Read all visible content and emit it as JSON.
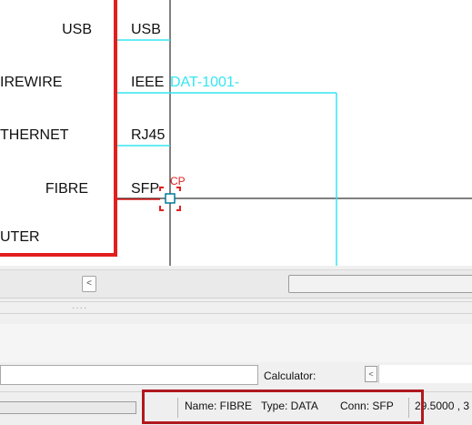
{
  "diagram": {
    "device_labels": [
      "USB",
      "IREWIRE",
      "THERNET",
      "FIBRE",
      "UTER"
    ],
    "connectors": [
      "USB",
      "IEEE",
      "RJ45",
      "SFP"
    ],
    "wire_label": "DAT-1001-",
    "cp_marker": "CP",
    "colors": {
      "device_border": "#e31e1e",
      "wire": "#33e6f0",
      "selection": "#e31e1e",
      "crosshair": "#000000"
    }
  },
  "scrollbar": {
    "left_arrow": "<",
    "grip": "····"
  },
  "input_bar": {
    "calculator_label": "Calculator:",
    "calc_arrow": "<"
  },
  "status_bar": {
    "name": "Name: FIBRE",
    "type": "Type: DATA",
    "conn": "Conn: SFP",
    "coords": "29.5000 , 3"
  }
}
